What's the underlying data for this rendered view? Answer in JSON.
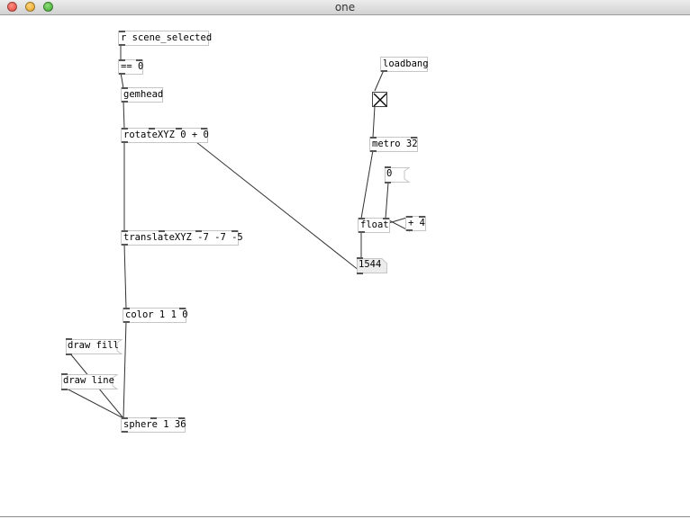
{
  "window": {
    "title": "one"
  },
  "objects": {
    "r_scene": "r scene_selected",
    "eq0": "== 0",
    "gemhead": "gemhead",
    "rotate": "rotateXYZ 0 + 0",
    "translate": "translateXYZ -7 -7 -5",
    "color": "color 1 1 0",
    "sphere": "sphere 1 36",
    "loadbang": "loadbang",
    "metro": "metro 32",
    "float": "float",
    "plus4": "+ 4"
  },
  "messages": {
    "draw_fill": "draw fill",
    "draw_line": "draw line",
    "zero": "0"
  },
  "numbers": {
    "counter": "1544"
  },
  "toggle": {
    "state": "on"
  }
}
